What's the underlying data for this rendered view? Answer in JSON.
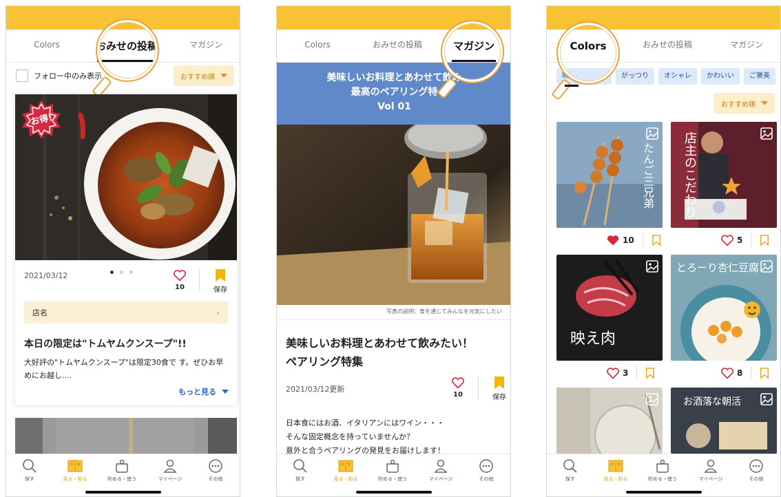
{
  "colors": {
    "brand_yellow": "#f7c233",
    "accent_orange": "#e3a019",
    "chip_blue": "#dce9fb",
    "banner_blue": "#5f89c9"
  },
  "tabs": {
    "colors": "Colors",
    "shop_posts": "おみせの投稿",
    "magazine": "マガジン"
  },
  "bottom_nav": [
    {
      "label": "探す",
      "icon": "search-icon"
    },
    {
      "label": "見る・知る",
      "icon": "book-icon"
    },
    {
      "label": "貯める・使う",
      "icon": "pot-icon"
    },
    {
      "label": "マイページ",
      "icon": "person-icon"
    },
    {
      "label": "その他",
      "icon": "more-icon"
    }
  ],
  "screen1": {
    "follow_only": "フォロー中のみ表示",
    "sort": "おすすめ順",
    "badge": "お得!",
    "date": "2021/03/12",
    "likes": "10",
    "save_label": "保存",
    "shop_name": "店名",
    "post_title": "本日の限定は\"トムヤムクンスープ\"!!",
    "post_body": "大好評の\"トムヤムクンスープ\"は限定30食で す。ぜひお早めにお越し....",
    "more": "もっと見る"
  },
  "screen2": {
    "banner_lines": [
      "美味しいお料理とあわせて飲み",
      "最高のペアリング特",
      "Vol 01"
    ],
    "caption": "写真の説明：食を通じてみんなを元気にしたい",
    "title_lines": [
      "美味しいお料理とあわせて飲みたい！",
      "ペアリング特集"
    ],
    "date": "2021/03/12更新",
    "likes": "10",
    "save_label": "保存",
    "body_lines": [
      "日本食にはお酒、イタリアンにはワイン・・・",
      "そんな固定概念を持っていませんか？",
      "意外と合うペアリングの発見をお届けします！"
    ]
  },
  "screen3": {
    "chips": [
      "映",
      "がっつり",
      "オシャレ",
      "かわいい",
      "ご褒美"
    ],
    "sort": "おすすめ順",
    "cards": [
      {
        "overlay": "たんご三兄弟",
        "likes": "10",
        "liked": true
      },
      {
        "overlay": "店主のこだわり",
        "likes": "5",
        "liked": false
      },
      {
        "overlay": "映え肉",
        "likes": "3",
        "liked": false
      },
      {
        "overlay": "とろーり杏仁豆腐",
        "likes": "8",
        "liked": false
      },
      {
        "overlay": "",
        "likes": "",
        "liked": false
      },
      {
        "overlay": "お酒落な朝活",
        "likes": "",
        "liked": false
      }
    ]
  }
}
